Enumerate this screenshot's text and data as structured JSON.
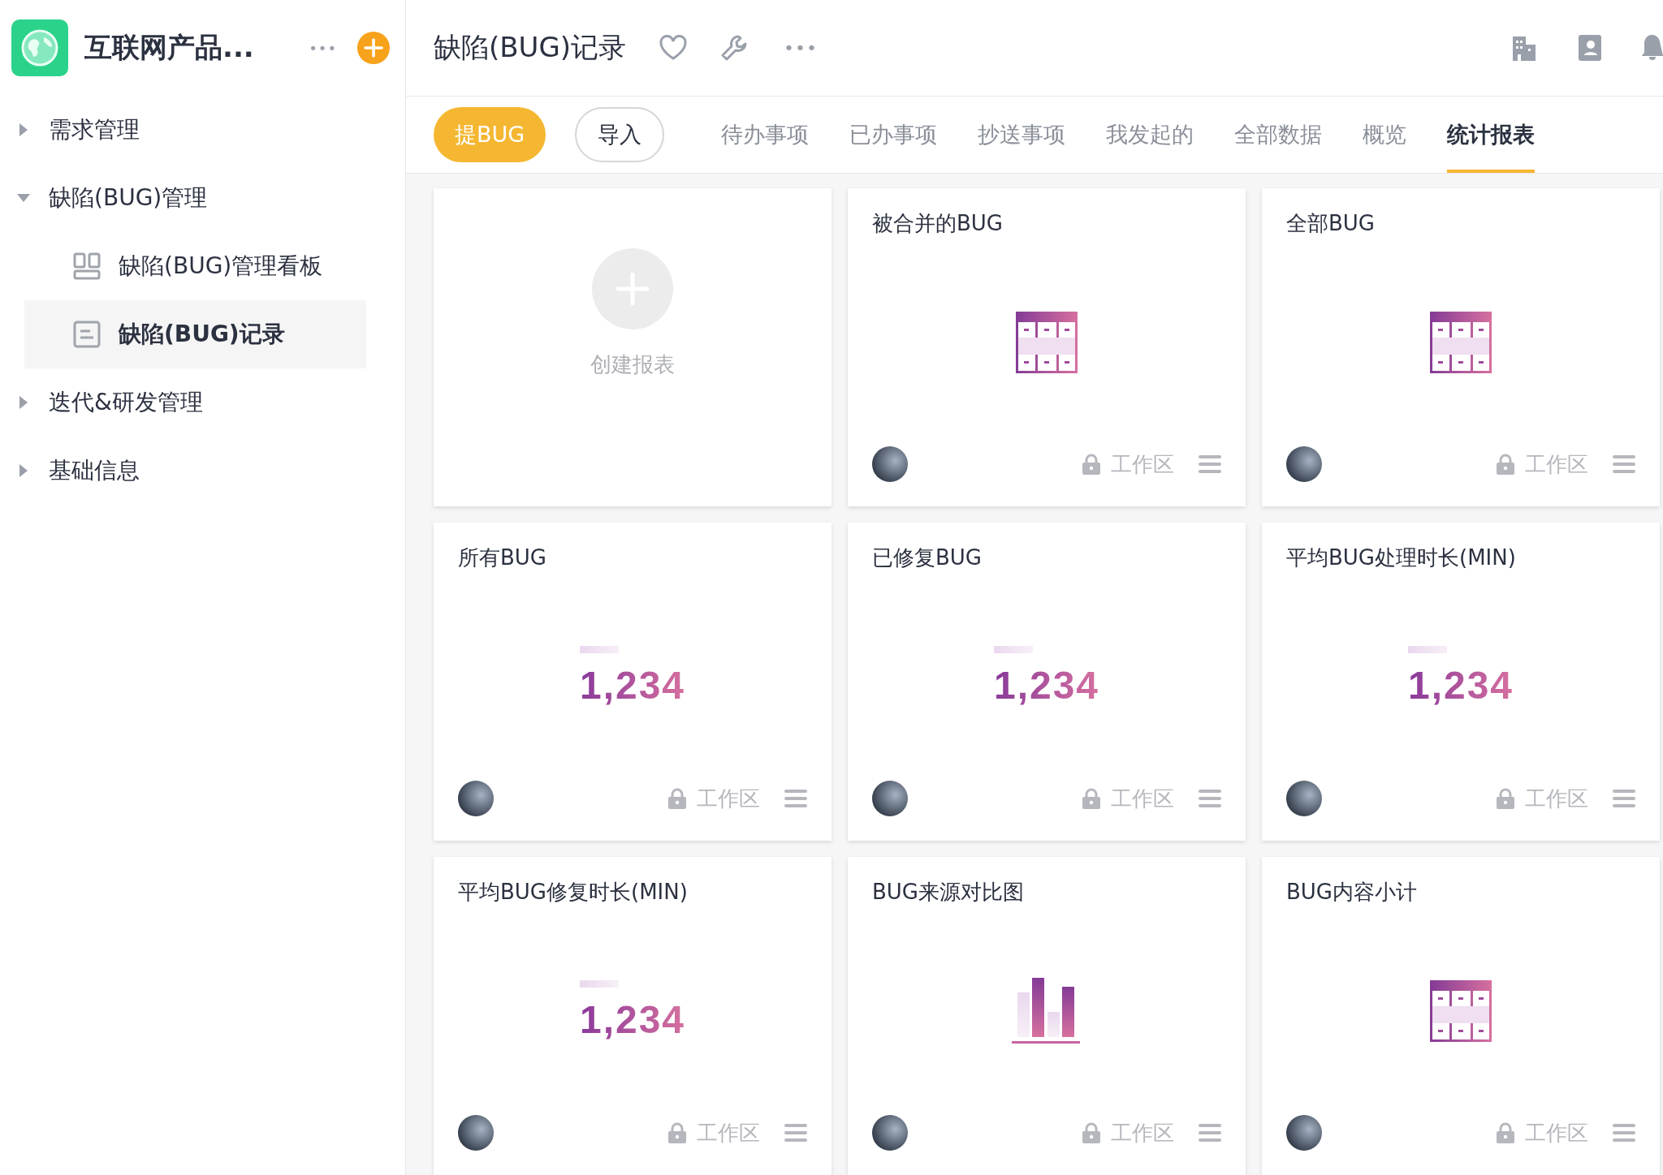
{
  "app": {
    "name": "互联网产品...",
    "more": "•••"
  },
  "sidebar": {
    "items": [
      {
        "label": "需求管理",
        "expanded": false,
        "selected": false
      },
      {
        "label": "缺陷(BUG)管理",
        "expanded": true,
        "selected": false,
        "children": [
          {
            "label": "缺陷(BUG)管理看板",
            "kind": "board",
            "selected": false
          },
          {
            "label": "缺陷(BUG)记录",
            "kind": "form",
            "selected": true
          }
        ]
      },
      {
        "label": "迭代&研发管理",
        "expanded": false,
        "selected": false
      },
      {
        "label": "基础信息",
        "expanded": false,
        "selected": false
      }
    ]
  },
  "header": {
    "title": "缺陷(BUG)记录",
    "more": "•••"
  },
  "buttons": [
    {
      "label": "提BUG",
      "kind": "primary"
    },
    {
      "label": "导入",
      "kind": "outline"
    }
  ],
  "tabs": [
    {
      "label": "待办事项",
      "selected": false
    },
    {
      "label": "已办事项",
      "selected": false
    },
    {
      "label": "抄送事项",
      "selected": false
    },
    {
      "label": "我发起的",
      "selected": false
    },
    {
      "label": "全部数据",
      "selected": false
    },
    {
      "label": "概览",
      "selected": false
    },
    {
      "label": "统计报表",
      "selected": true
    }
  ],
  "cards": [
    {
      "kind": "create",
      "label": "创建报表"
    },
    {
      "kind": "table",
      "title": "被合并的BUG",
      "scope": "工作区"
    },
    {
      "kind": "table",
      "title": "全部BUG",
      "scope": "工作区"
    },
    {
      "kind": "number",
      "title": "所有BUG",
      "value": "1,234",
      "scope": "工作区"
    },
    {
      "kind": "number",
      "title": "已修复BUG",
      "value": "1,234",
      "scope": "工作区"
    },
    {
      "kind": "number",
      "title": "平均BUG处理时长(MIN)",
      "value": "1,234",
      "scope": "工作区"
    },
    {
      "kind": "number",
      "title": "平均BUG修复时长(MIN)",
      "value": "1,234",
      "scope": "工作区"
    },
    {
      "kind": "bar",
      "title": "BUG来源对比图",
      "scope": "工作区"
    },
    {
      "kind": "table",
      "title": "BUG内容小计",
      "scope": "工作区"
    }
  ]
}
